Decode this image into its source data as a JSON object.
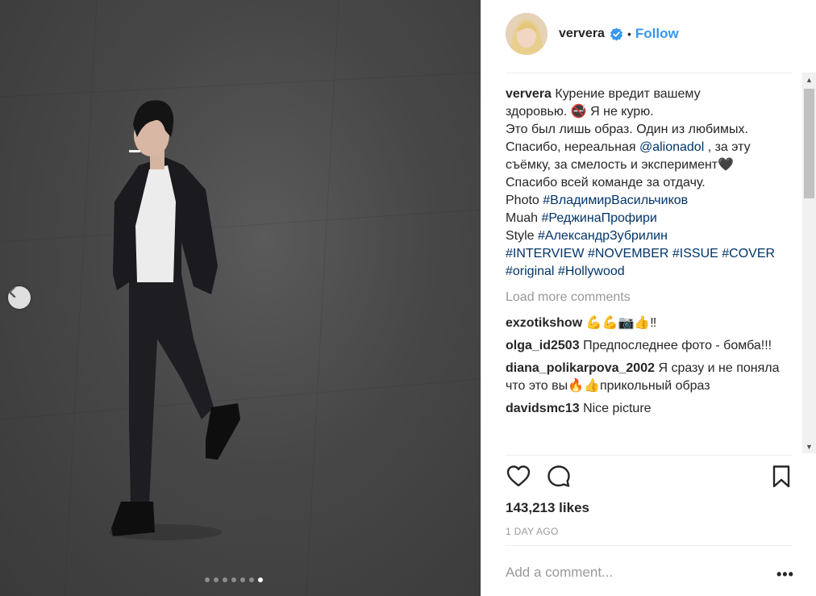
{
  "post": {
    "username": "ververa",
    "follow_label": "Follow",
    "separator": "•",
    "caption_lines": [
      "Курение вредит вашему",
      "здоровью. 🚭 Я не курю.",
      "Это был лишь образ. Один из любимых.",
      "Спасибо, нереальная ",
      "@alionadol",
      " , за эту",
      "съёмку, за смелость и эксперимент🖤",
      "Спасибо всей команде за отдачу.",
      "Photo ",
      "#ВладимирВасильчиков",
      "Muah ",
      "#РеджинаПрофири",
      "Style ",
      "#АлександрЗубрилин"
    ],
    "hashtags_line1": [
      "#INTERVIEW",
      "#NOVEMBER",
      "#ISSUE",
      "#COVER"
    ],
    "hashtags_line2": [
      "#original",
      "#Hollywood"
    ],
    "load_more": "Load more comments",
    "comments": [
      {
        "user": "exzotikshow",
        "text": "💪💪📷👍‼"
      },
      {
        "user": "olga_id2503",
        "text": "Предпоследнее фото - бомба!!!"
      },
      {
        "user": "diana_polikarpova_2002",
        "text": "Я сразу и не поняла что это вы🔥👍прикольный образ"
      },
      {
        "user": "davidsmc13",
        "text": "Nice picture"
      }
    ],
    "likes": "143,213 likes",
    "time": "1 DAY AGO",
    "add_comment_placeholder": "Add a comment...",
    "more_label": "•••"
  },
  "carousel": {
    "total_slides": 7,
    "active_slide": 7
  },
  "icons": {
    "verified": "verified-badge-icon",
    "like": "heart-icon",
    "comment": "comment-bubble-icon",
    "save": "bookmark-icon",
    "prev": "chevron-left-icon"
  },
  "colors": {
    "accent": "#3897f0",
    "hashtag": "#003569",
    "muted": "#999999",
    "text": "#262626"
  }
}
